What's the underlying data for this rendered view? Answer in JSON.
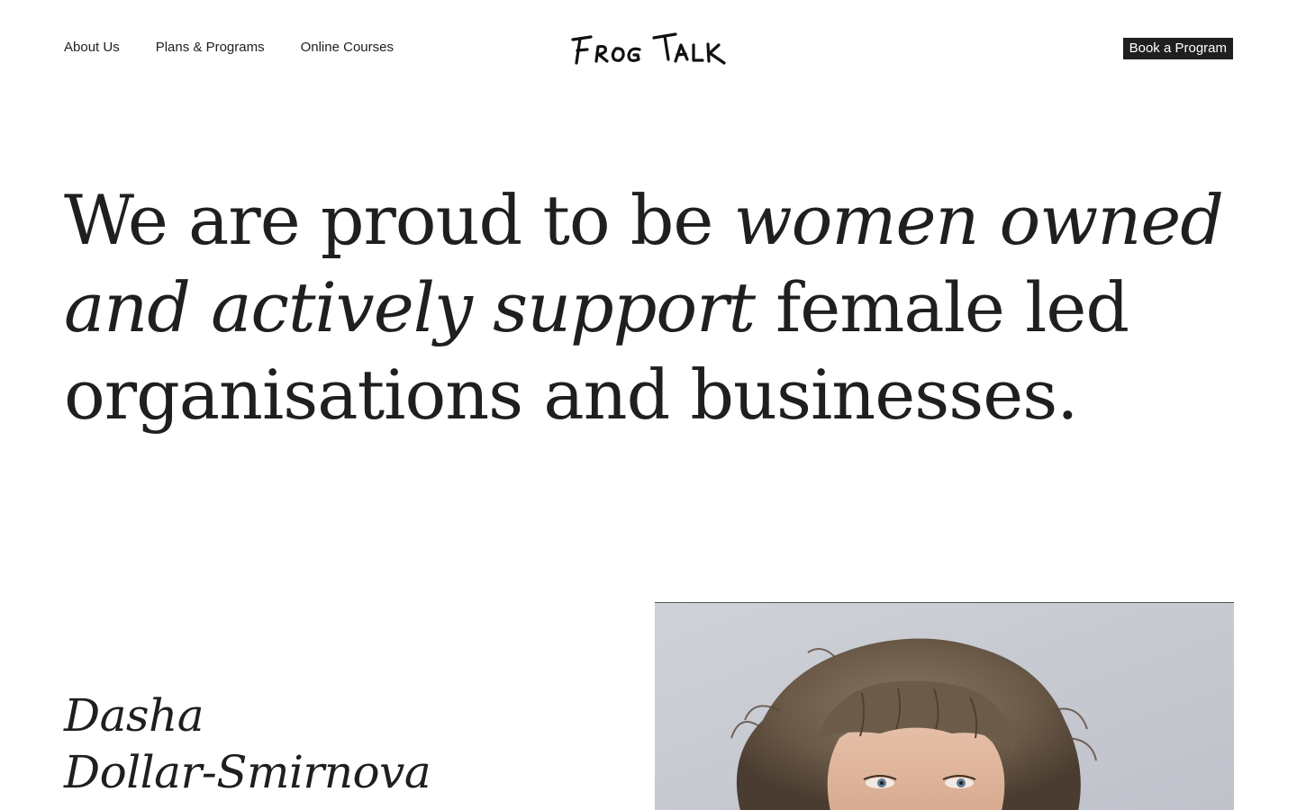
{
  "nav": {
    "items": [
      {
        "label": "About Us"
      },
      {
        "label": "Plans & Programs"
      },
      {
        "label": "Online Courses"
      }
    ]
  },
  "logo": {
    "text": "Frog Talk",
    "icon": "frog-talk-logo"
  },
  "header": {
    "cta_label": "Book a Program"
  },
  "statement": {
    "part1": "We are proud to be ",
    "emphasis": "women owned and actively support",
    "part2": " female led organisations and businesses."
  },
  "profile": {
    "first_name": "Dasha",
    "last_name": "Dollar-Smirnova",
    "photo": "portrait-photo"
  },
  "colors": {
    "text": "#1f1f1f",
    "background": "#ffffff",
    "button_bg": "#1f1f1f",
    "button_text": "#ffffff",
    "photo_backdrop": "#c9cbd3"
  }
}
